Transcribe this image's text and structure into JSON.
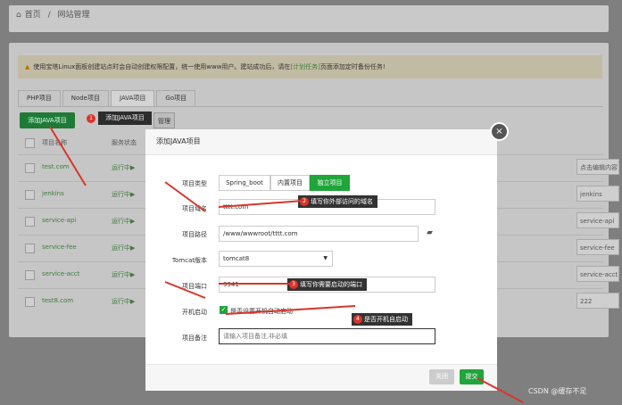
{
  "breadcrumb": {
    "home": "首页",
    "sep": "/",
    "current": "网站管理"
  },
  "notice": {
    "text": "使用宝塔Linux面板创建站点时会自动创建权限配置，统一使用www用户。建站成功后，请在",
    "link": "[计划任务]",
    "tail": "页面添加定时备份任务!"
  },
  "tabs": [
    "PHP项目",
    "Node项目",
    "JAVA项目",
    "Go项目"
  ],
  "toolbar": {
    "add_java": "添加JAVA项目",
    "mgmt": "管理"
  },
  "tooltip1": "添加JAVA项目",
  "table": {
    "headers": [
      "项目名称",
      "服务状态"
    ],
    "rows": [
      {
        "name": "test.com",
        "status": "运行中▶",
        "remark": "点击编辑内容"
      },
      {
        "name": "jenkins",
        "status": "运行中▶",
        "remark": "jenkins"
      },
      {
        "name": "service-api",
        "status": "运行中▶",
        "remark": "service-api"
      },
      {
        "name": "service-fee",
        "status": "运行中▶",
        "remark": "service-fee"
      },
      {
        "name": "service-acct",
        "status": "运行中▶",
        "remark": "service-acct"
      },
      {
        "name": "test8.com",
        "status": "运行中▶",
        "remark": "222"
      }
    ]
  },
  "modal": {
    "title": "添加JAVA项目",
    "close": "×",
    "type_label": "项目类型",
    "types": [
      "Spring_boot",
      "内置项目",
      "独立项目"
    ],
    "domain_label": "项目域名",
    "domain_value": "tttt.com",
    "path_label": "项目路径",
    "path_value": "/www/wwwroot/tttt.com",
    "tomcat_label": "Tomcat版本",
    "tomcat_value": "tomcat8",
    "port_label": "项目端口",
    "port_value": "9941",
    "autostart_label": "开机启动",
    "autostart_text": "是否设置开机自动启动",
    "remark_label": "项目备注",
    "remark_placeholder": "请输入项目备注,非必填",
    "btn_close": "关闭",
    "btn_submit": "提交"
  },
  "tips": {
    "t2": "填写你外部访问的域名",
    "t3": "填写你需要启动的端口",
    "t4": "是否开机自启动"
  },
  "tip_nums": [
    "1",
    "2",
    "3",
    "4"
  ],
  "watermark": "CSDN @缓存不足",
  "colors": {
    "green": "#20a53a",
    "red": "#d9352b"
  }
}
